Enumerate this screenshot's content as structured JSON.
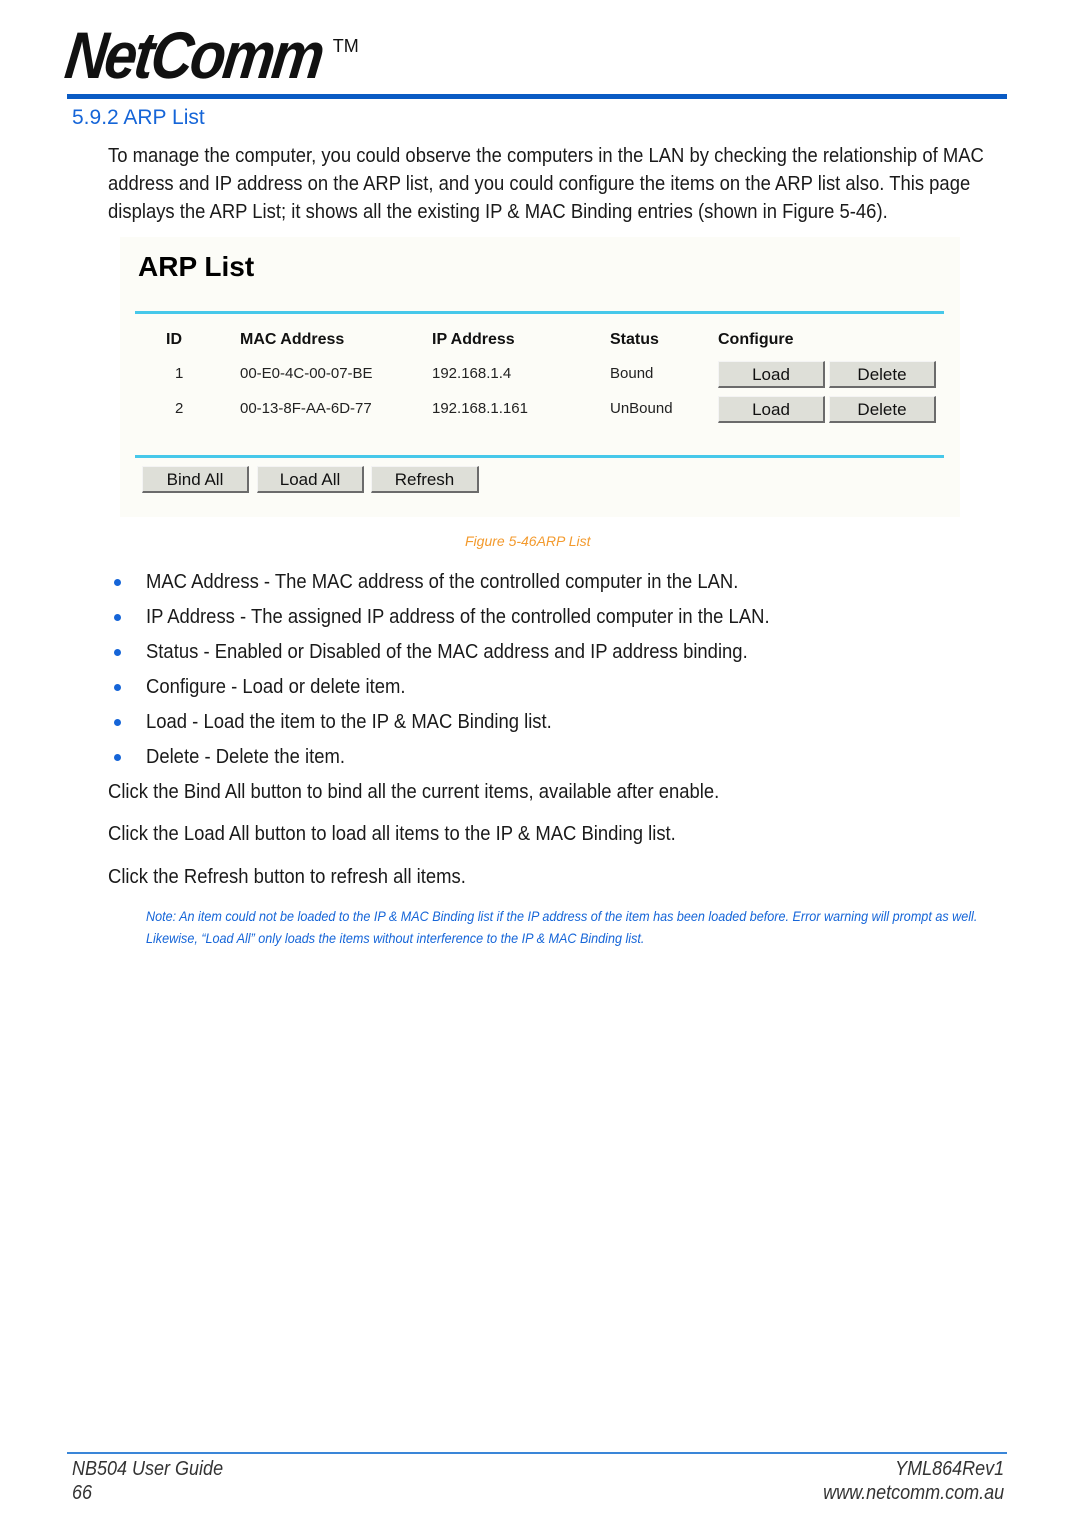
{
  "header": {
    "logo_text": "NetComm",
    "logo_tm": "TM",
    "section_title": "5.9.2 ARP List"
  },
  "intro": "To manage the computer, you could observe the computers in the LAN by checking the relationship of MAC address and IP address on the ARP list, and you could configure the items on the ARP list also. This page displays the ARP List; it shows all the existing IP & MAC Binding entries (shown in Figure 5-46).",
  "figure": {
    "title": "ARP List",
    "columns": [
      "ID",
      "MAC Address",
      "IP Address",
      "Status",
      "Configure"
    ],
    "rows": [
      {
        "id": "1",
        "mac": "00-E0-4C-00-07-BE",
        "ip": "192.168.1.4",
        "status": "Bound",
        "load_label": "Load",
        "delete_label": "Delete"
      },
      {
        "id": "2",
        "mac": "00-13-8F-AA-6D-77",
        "ip": "192.168.1.161",
        "status": "UnBound",
        "load_label": "Load",
        "delete_label": "Delete"
      }
    ],
    "buttons": {
      "bind_all": "Bind All",
      "load_all": "Load All",
      "refresh": "Refresh"
    },
    "caption": "Figure 5-46ARP List"
  },
  "bullets": [
    {
      "term": "MAC Address",
      "desc": " - The MAC address of the controlled computer in the LAN."
    },
    {
      "term": "IP Address",
      "desc": " - The assigned IP address of the controlled computer in the LAN."
    },
    {
      "term": "Status",
      "desc": " - Enabled or Disabled of the MAC address and IP address binding."
    },
    {
      "term": "Configure",
      "desc": " - Load or delete item."
    },
    {
      "term": "Load",
      "desc": " - Load the item to the IP & MAC Binding list."
    },
    {
      "term": "Delete",
      "desc": " - Delete the item."
    }
  ],
  "paragraphs": [
    "Click the Bind All button to bind all the current items, available after enable.",
    "Click the Load All button to load all items to the IP & MAC Binding list.",
    "Click the Refresh button to refresh all items."
  ],
  "note": "Note: An item could not be loaded to the IP & MAC Binding list if the IP address of the item has been loaded before. Error warning will prompt as well. Likewise, “Load All” only loads the items without interference to the IP & MAC Binding list.",
  "footer": {
    "guide": "NB504 User Guide",
    "page": "66",
    "rev": "YML864Rev1",
    "url": "www.netcomm.com.au"
  },
  "colors": {
    "accent_blue": "#1565d8",
    "rule_cyan": "#46c8ea",
    "caption_orange": "#f39a2d"
  }
}
